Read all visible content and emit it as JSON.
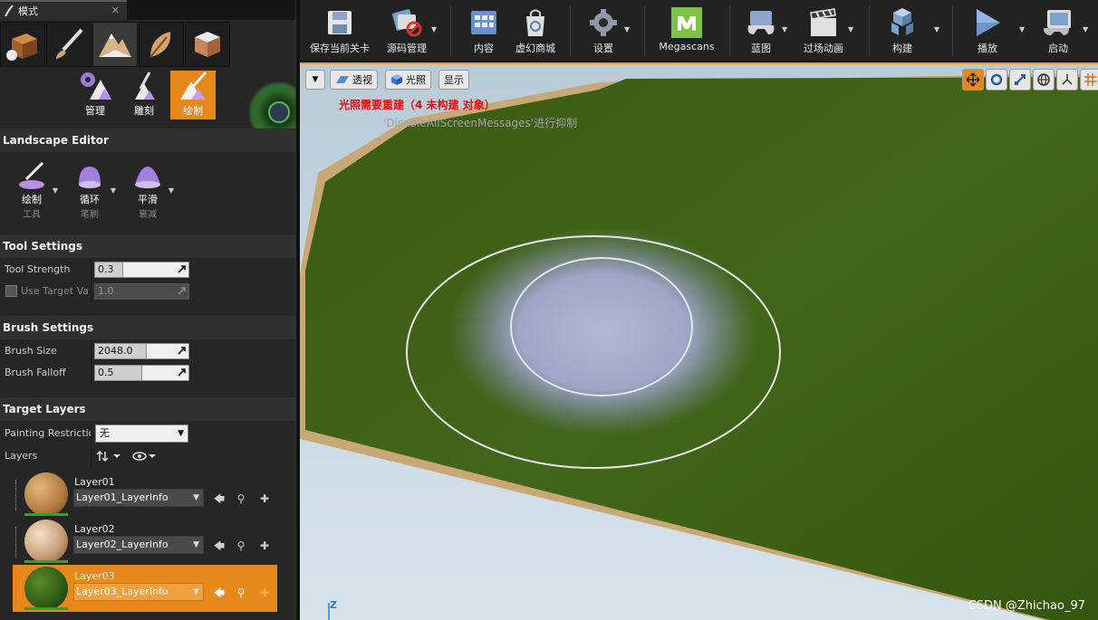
{
  "tab": {
    "title": "模式",
    "close": "✕"
  },
  "modes": [
    "place-mode",
    "paint-mode",
    "landscape-mode",
    "foliage-mode",
    "geometry-mode"
  ],
  "sub_modes": [
    {
      "label": "管理"
    },
    {
      "label": "雕刻"
    },
    {
      "label": "绘制"
    }
  ],
  "landscape_editor": {
    "title": "Landscape Editor"
  },
  "tools": [
    {
      "line1": "绘制",
      "line2": "工具"
    },
    {
      "line1": "循环",
      "line2": "笔刷"
    },
    {
      "line1": "平滑",
      "line2": "衰减"
    }
  ],
  "tool_settings": {
    "title": "Tool Settings",
    "strength_label": "Tool Strength",
    "strength_value": "0.3",
    "strength_fraction": 0.3,
    "use_target_label": "Use Target Value",
    "use_target_value": "1.0",
    "use_target_fraction": 1.0
  },
  "brush_settings": {
    "title": "Brush Settings",
    "size_label": "Brush Size",
    "size_value": "2048.0",
    "size_fraction": 0.55,
    "falloff_label": "Brush Falloff",
    "falloff_value": "0.5",
    "falloff_fraction": 0.5
  },
  "target_layers": {
    "title": "Target Layers",
    "restriction_label": "Painting Restriction",
    "restriction_value": "无",
    "layers_label": "Layers",
    "items": [
      {
        "name": "Layer01",
        "info": "Layer01_LayerInfo"
      },
      {
        "name": "Layer02",
        "info": "Layer02_LayerInfo"
      },
      {
        "name": "Layer03",
        "info": "Layer03_LayerInfo"
      }
    ]
  },
  "toolbar": {
    "save": "保存当前关卡",
    "source": "源码管理",
    "content": "内容",
    "market": "虚幻商城",
    "settings": "设置",
    "megascans": "Megascans",
    "blueprint": "蓝图",
    "cinematics": "过场动画",
    "build": "构建",
    "play": "播放",
    "launch": "启动"
  },
  "viewport": {
    "perspective": "透视",
    "lit": "光照",
    "show": "显示",
    "lighting_msg": "光照需要重建（4 未构建 对象）",
    "disable_msg": "'DisableAllScreenMessages'进行抑制",
    "axis": "Z"
  },
  "watermark": "CSDN @Zhichao_97"
}
